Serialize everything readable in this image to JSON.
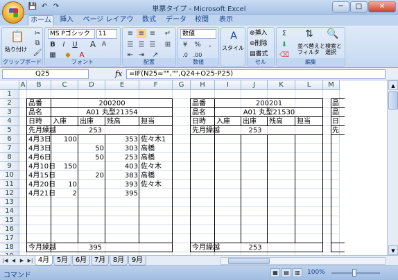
{
  "window": {
    "title": "単票タイプ - Microsoft Excel",
    "min": "─",
    "max": "□",
    "close": "✕"
  },
  "qat": {
    "save": "💾",
    "undo": "↶",
    "redo": "↷"
  },
  "tabs": [
    "ホーム",
    "挿入",
    "ページ レイアウト",
    "数式",
    "データ",
    "校閲",
    "表示"
  ],
  "ribbon": {
    "clipboard": {
      "paste": "貼り付け",
      "label": "クリップボード"
    },
    "font": {
      "name": "MS Pゴシック",
      "size": "11",
      "bold": "B",
      "italic": "I",
      "underline": "U",
      "grow": "A",
      "shrink": "A",
      "label": "フォント"
    },
    "alignment": {
      "label": "配置"
    },
    "number": {
      "format": "数値",
      "label": "数値"
    },
    "styles": {
      "style": "スタイル"
    },
    "cells": {
      "insert": "挿入",
      "delete": "削除",
      "format": "書式",
      "label": "セル"
    },
    "editing": {
      "sort": "並べ替えと\nフィルタ",
      "find": "検索と\n選択",
      "label": "編集"
    }
  },
  "formula_bar": {
    "name_box": "Q25",
    "fx": "fx",
    "formula": "=IF(N25=\"\",\"\",Q24+O25-P25)"
  },
  "columns": [
    "A",
    "B",
    "C",
    "D",
    "E",
    "F",
    "G",
    "H",
    "I",
    "J",
    "K",
    "L",
    "M"
  ],
  "rows": [
    "1",
    "2",
    "3",
    "4",
    "5",
    "6",
    "7",
    "8",
    "9",
    "10",
    "11",
    "12",
    "13",
    "14",
    "15",
    "16",
    "17",
    "18",
    "19"
  ],
  "card1": {
    "product_no_label": "品番",
    "product_no": "200200",
    "product_name_label": "品名",
    "product_name": "A01 丸型21354",
    "headers": [
      "日時",
      "入庫",
      "出庫",
      "残高",
      "担当"
    ],
    "carryover_label": "先月繰越",
    "carryover": "253",
    "entries": [
      {
        "date": "4月3日",
        "in": "100",
        "out": "",
        "bal": "353",
        "staff": "佐々木1"
      },
      {
        "date": "4月3日",
        "in": "",
        "out": "50",
        "bal": "303",
        "staff": "高橋"
      },
      {
        "date": "4月6日",
        "in": "",
        "out": "50",
        "bal": "253",
        "staff": "高橋"
      },
      {
        "date": "4月10日",
        "in": "150",
        "out": "",
        "bal": "403",
        "staff": "佐々木"
      },
      {
        "date": "4月15日",
        "in": "",
        "out": "20",
        "bal": "383",
        "staff": "高橋"
      },
      {
        "date": "4月20日",
        "in": "10",
        "out": "",
        "bal": "393",
        "staff": "佐々木"
      },
      {
        "date": "4月21日",
        "in": "2",
        "out": "",
        "bal": "395",
        "staff": ""
      }
    ],
    "nextmonth_label": "今月繰越",
    "nextmonth": "395"
  },
  "card2": {
    "product_no_label": "品番",
    "product_no": "200201",
    "product_name_label": "品名",
    "product_name": "A01 丸型21530",
    "headers": [
      "日時",
      "入庫",
      "出庫",
      "残高",
      "担当"
    ],
    "carryover_label": "先月繰越",
    "carryover": "253",
    "nextmonth_label": "今月繰越",
    "nextmonth": "253"
  },
  "card3_partial": {
    "r2": "品",
    "r3": "品",
    "r4": "日",
    "r5": "先"
  },
  "sheets": [
    "4月",
    "5月",
    "6月",
    "7月",
    "8月",
    "9月"
  ],
  "status": {
    "mode": "コマンド",
    "zoom": "100%"
  }
}
